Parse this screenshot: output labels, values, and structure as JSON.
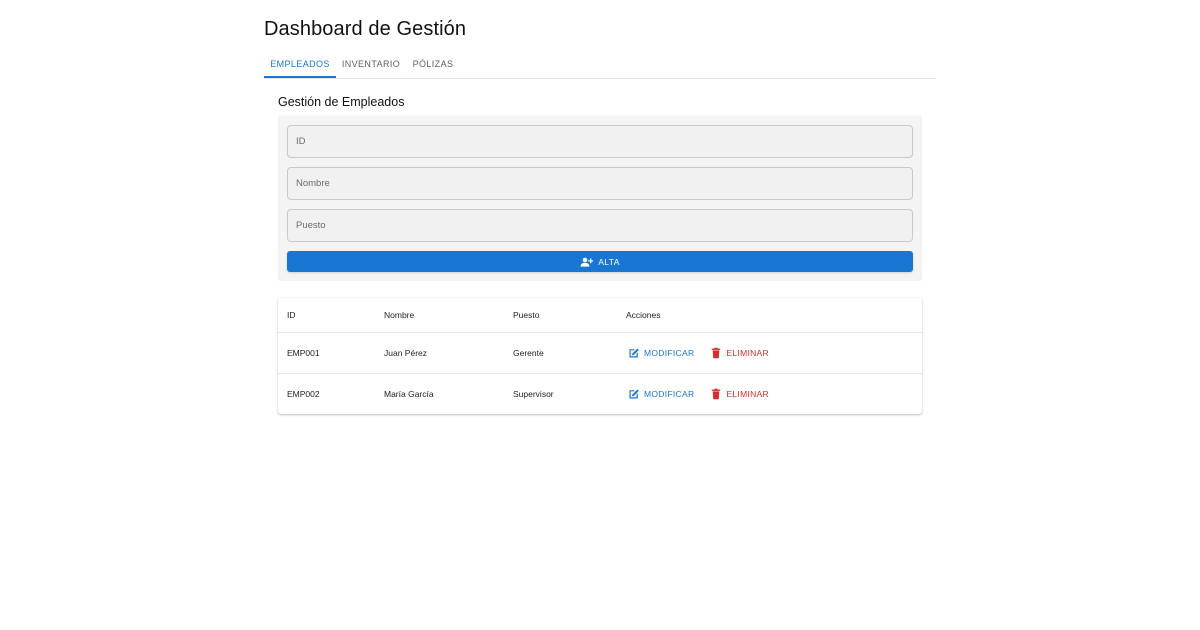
{
  "header": {
    "title": "Dashboard de Gestión"
  },
  "tabs": [
    {
      "label": "EMPLEADOS",
      "active": true
    },
    {
      "label": "INVENTARIO",
      "active": false
    },
    {
      "label": "PÓLIZAS",
      "active": false
    }
  ],
  "form": {
    "title": "Gestión de Empleados",
    "fields": {
      "id": {
        "placeholder": "ID",
        "value": ""
      },
      "nombre": {
        "placeholder": "Nombre",
        "value": ""
      },
      "puesto": {
        "placeholder": "Puesto",
        "value": ""
      }
    },
    "submit_label": "ALTA",
    "submit_icon": "person-add-icon"
  },
  "table": {
    "columns": [
      "ID",
      "Nombre",
      "Puesto",
      "Acciones"
    ],
    "rows": [
      {
        "id": "EMP001",
        "nombre": "Juan Pérez",
        "puesto": "Gerente"
      },
      {
        "id": "EMP002",
        "nombre": "María García",
        "puesto": "Supervisor"
      }
    ],
    "actions": {
      "modify_label": "MODIFICAR",
      "modify_icon": "edit-icon",
      "delete_label": "ELIMINAR",
      "delete_icon": "trash-icon"
    }
  },
  "colors": {
    "primary": "#1976d2",
    "danger": "#d32f2f",
    "form_background": "#f4f4f4"
  }
}
